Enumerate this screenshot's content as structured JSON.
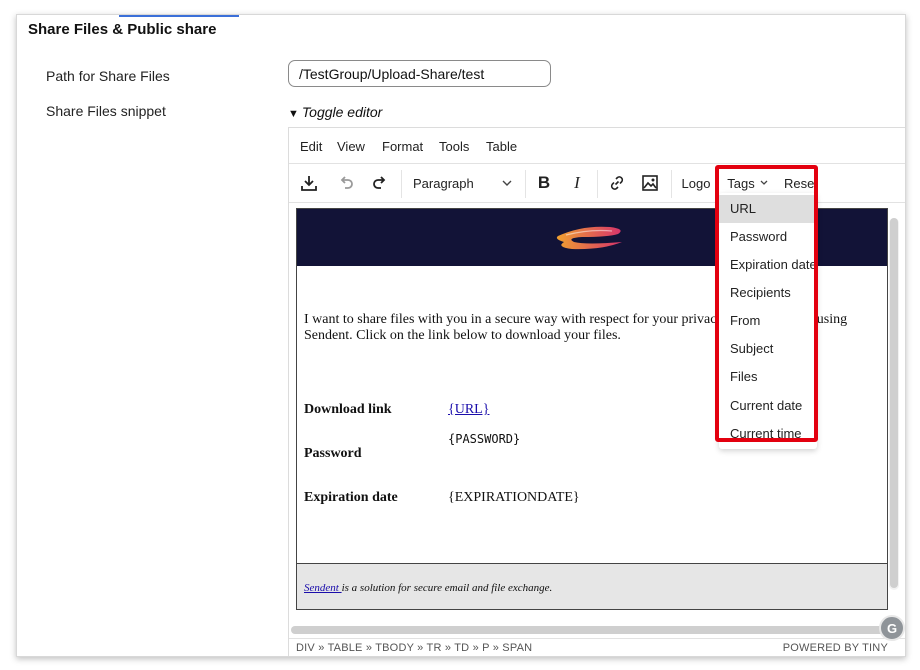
{
  "section": {
    "title": "Share Files & Public share"
  },
  "fields": {
    "path_label": "Path for Share Files",
    "path_value": "/TestGroup/Upload-Share/test",
    "snippet_label": "Share Files snippet"
  },
  "toggle": {
    "label": "Toggle editor"
  },
  "menubar": {
    "edit": "Edit",
    "view": "View",
    "format": "Format",
    "tools": "Tools",
    "table": "Table"
  },
  "toolbar": {
    "block_format": "Paragraph",
    "logo": "Logo",
    "tags": "Tags",
    "reset": "Reset",
    "icons": [
      "download-icon",
      "undo-icon",
      "redo-icon",
      "chevron-down-icon",
      "bold-icon",
      "italic-icon",
      "link-icon",
      "image-icon"
    ]
  },
  "tags_menu": [
    "URL",
    "Password",
    "Expiration date",
    "Recipients",
    "From",
    "Subject",
    "Files",
    "Current date",
    "Current time"
  ],
  "content": {
    "body_text": "I want to share files with you in a secure way with respect for your privacy. Therefore I am using Sendent. Click on the link below to download your files.",
    "download_label": "Download link",
    "download_value": "{URL}",
    "password_label": "Password",
    "password_value": "{PASSWORD}",
    "expiration_label": "Expiration date",
    "expiration_value": "{EXPIRATIONDATE}",
    "footer_link": "Sendent ",
    "footer_rest": "is a solution for secure email and file exchange."
  },
  "statusbar": {
    "path": "DIV » TABLE » TBODY » TR » TD » P » SPAN",
    "powered": "POWERED BY TINY"
  },
  "grammarly": {
    "letter": "G"
  },
  "colors": {
    "banner": "#121337",
    "highlight": "#e3000f",
    "link": "#1a0dab",
    "logo_orange": "#f07b2c",
    "logo_pink": "#d6336c"
  }
}
